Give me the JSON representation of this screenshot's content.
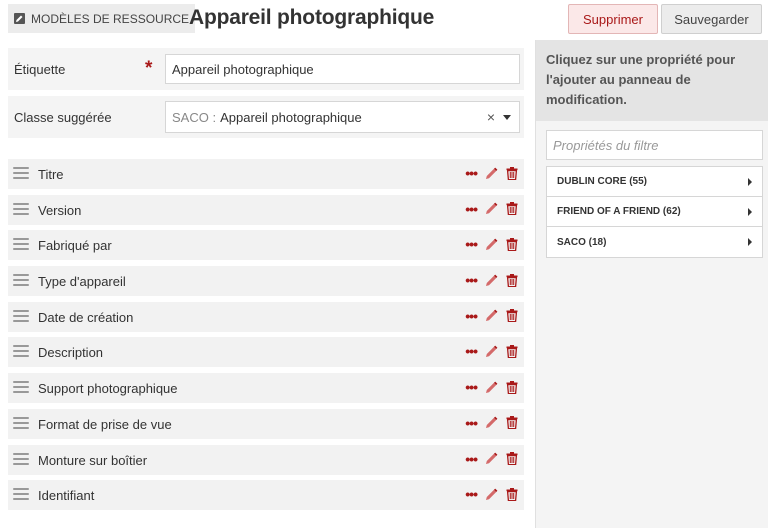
{
  "header": {
    "breadcrumb": "MODÈLES DE RESSOURCE",
    "title": "Appareil photographique",
    "delete_label": "Supprimer",
    "save_label": "Sauvegarder"
  },
  "form": {
    "label_field": {
      "label": "Étiquette",
      "required_mark": "*",
      "value": "Appareil photographique"
    },
    "class_field": {
      "label": "Classe suggérée",
      "prefix": "SACO :",
      "value": "Appareil photographique",
      "clear": "×"
    }
  },
  "properties": [
    {
      "label": "Titre"
    },
    {
      "label": "Version"
    },
    {
      "label": "Fabriqué par"
    },
    {
      "label": "Type d'appareil"
    },
    {
      "label": "Date de création"
    },
    {
      "label": "Description"
    },
    {
      "label": "Support photographique"
    },
    {
      "label": "Format de prise de vue"
    },
    {
      "label": "Monture sur boîtier"
    },
    {
      "label": "Identifiant"
    }
  ],
  "sidebar": {
    "instruction": "Cliquez sur une propriété pour l'ajouter au panneau de modification.",
    "filter_placeholder": "Propriétés du filtre",
    "vocabularies": [
      {
        "label": "DUBLIN CORE (55)"
      },
      {
        "label": "FRIEND OF A FRIEND (62)"
      },
      {
        "label": "SACO (18)"
      }
    ]
  },
  "colors": {
    "accent_red": "#a91919",
    "panel_gray": "#f4f4f4"
  }
}
